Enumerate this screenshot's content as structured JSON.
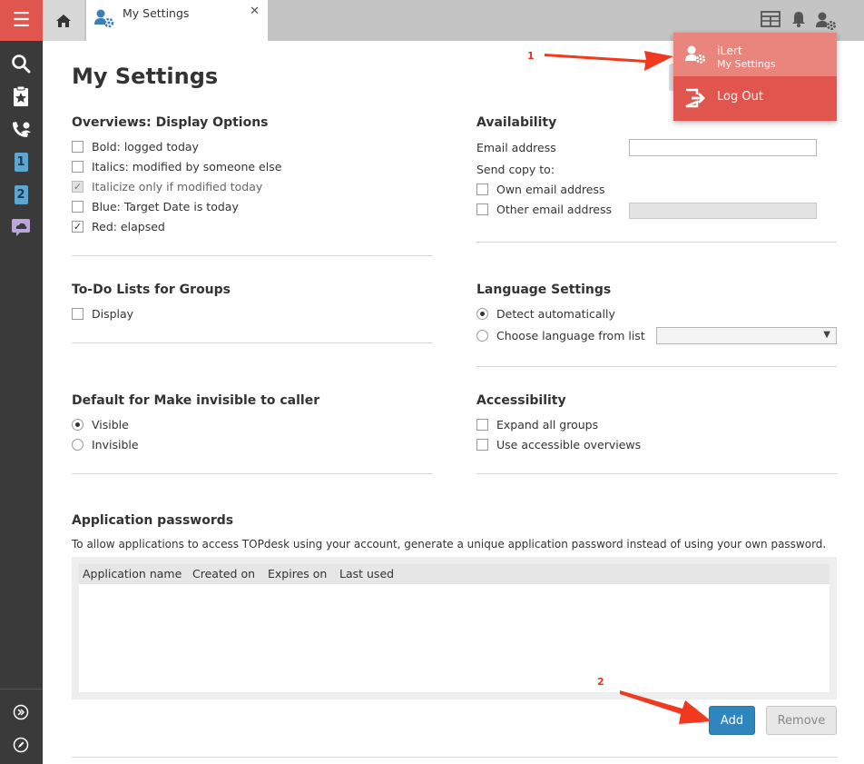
{
  "sidebar": {
    "menu_icon": "hamburger-icon",
    "items": [
      {
        "icon": "search-icon"
      },
      {
        "icon": "starred-clipboard-icon"
      },
      {
        "icon": "operator-call-icon"
      },
      {
        "icon": "first-line-badge-icon",
        "label": "1"
      },
      {
        "icon": "second-line-badge-icon",
        "label": "2"
      },
      {
        "icon": "knowledge-cloud-icon"
      }
    ],
    "bottom": [
      {
        "icon": "expand-icon"
      },
      {
        "icon": "edit-icon"
      }
    ]
  },
  "tabs": [
    {
      "label": "My Settings",
      "icon": "user-settings-icon",
      "closable": true
    }
  ],
  "topbar_icons": [
    "layout-icon",
    "bell-icon",
    "user-settings-icon"
  ],
  "page": {
    "title": "My Settings"
  },
  "overviews": {
    "title": "Overviews: Display Options",
    "options": [
      {
        "label": "Bold: logged today",
        "checked": false,
        "disabled": false
      },
      {
        "label": "Italics: modified by someone else",
        "checked": false,
        "disabled": false
      },
      {
        "label": "Italicize only if modified today",
        "checked": true,
        "disabled": true
      },
      {
        "label": "Blue: Target Date is today",
        "checked": false,
        "disabled": false
      },
      {
        "label": "Red: elapsed",
        "checked": true,
        "disabled": false
      }
    ]
  },
  "availability": {
    "title": "Availability",
    "email_label": "Email address",
    "email_value": "",
    "send_copy_label": "Send copy to:",
    "own_email_label": "Own email address",
    "other_email_label": "Other email address",
    "other_email_value": ""
  },
  "todo": {
    "title": "To-Do Lists for Groups",
    "display_label": "Display"
  },
  "language": {
    "title": "Language Settings",
    "detect_label": "Detect automatically",
    "choose_label": "Choose language from list",
    "selected": ""
  },
  "invisible": {
    "title": "Default for Make invisible to caller",
    "visible_label": "Visible",
    "invisible_label": "Invisible"
  },
  "accessibility": {
    "title": "Accessibility",
    "expand_label": "Expand all groups",
    "accessible_label": "Use accessible overviews"
  },
  "app_passwords": {
    "title": "Application passwords",
    "description": "To allow applications to access TOPdesk using your account, generate a unique application password instead of using your own password.",
    "columns": [
      "Application name",
      "Created on",
      "Expires on",
      "Last used"
    ],
    "rows": [],
    "add_label": "Add",
    "remove_label": "Remove"
  },
  "user_menu": {
    "name": "iLert",
    "subtitle": "My Settings",
    "logout_label": "Log Out"
  },
  "annotations": [
    "1",
    "2"
  ],
  "colors": {
    "accent_red": "#e0564f",
    "accent_red_light": "#ea857d",
    "primary_blue": "#2f86bf",
    "annotation_red": "#e8321e"
  }
}
